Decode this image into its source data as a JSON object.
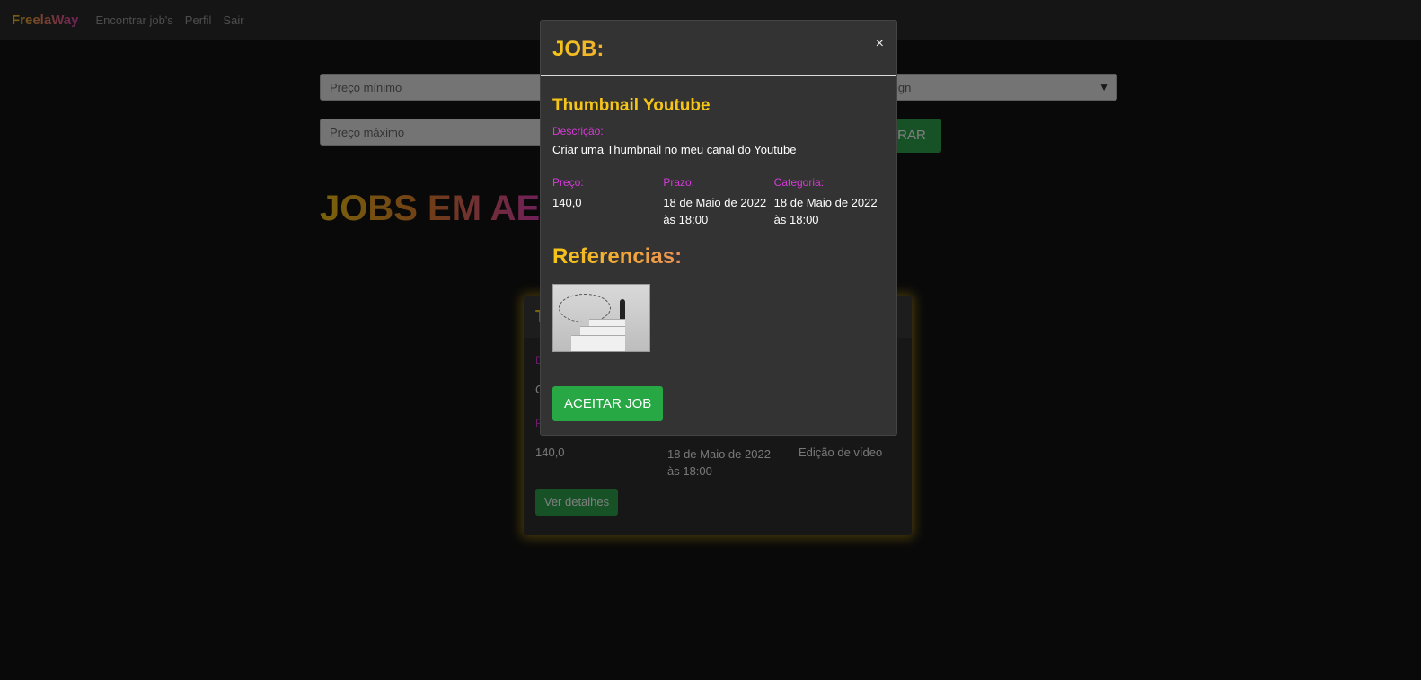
{
  "navbar": {
    "brand": "FreelaWay",
    "links": [
      "Encontrar job's",
      "Perfil",
      "Sair"
    ]
  },
  "filters": {
    "min_price_placeholder": "Preço mínimo",
    "max_price_placeholder": "Preço máximo",
    "category_partial": "ign",
    "filter_button_partial": "TRAR"
  },
  "page": {
    "heading_partial": "JOBS EM AE"
  },
  "job_card": {
    "title_partial": "T",
    "desc_label_partial": "D",
    "desc_partial": "C",
    "price_label_partial": "P",
    "price": "140,0",
    "deadline": "18 de Maio de 2022 às 18:00",
    "category": "Edição de vídeo",
    "details_button": "Ver detalhes"
  },
  "modal": {
    "title": "JOB:",
    "close_symbol": "×",
    "job_title": "Thumbnail Youtube",
    "desc_label": "Descrição:",
    "desc_text": "Criar uma Thumbnail no meu canal do Youtube",
    "price_label": "Preço:",
    "price_value": "140,0",
    "deadline_label": "Prazo:",
    "deadline_value": "18 de Maio de 2022 às 18:00",
    "category_label": "Categoria:",
    "category_value": "18 de Maio de 2022 às 18:00",
    "references_title": "Referencias:",
    "accept_button": "ACEITAR JOB"
  }
}
